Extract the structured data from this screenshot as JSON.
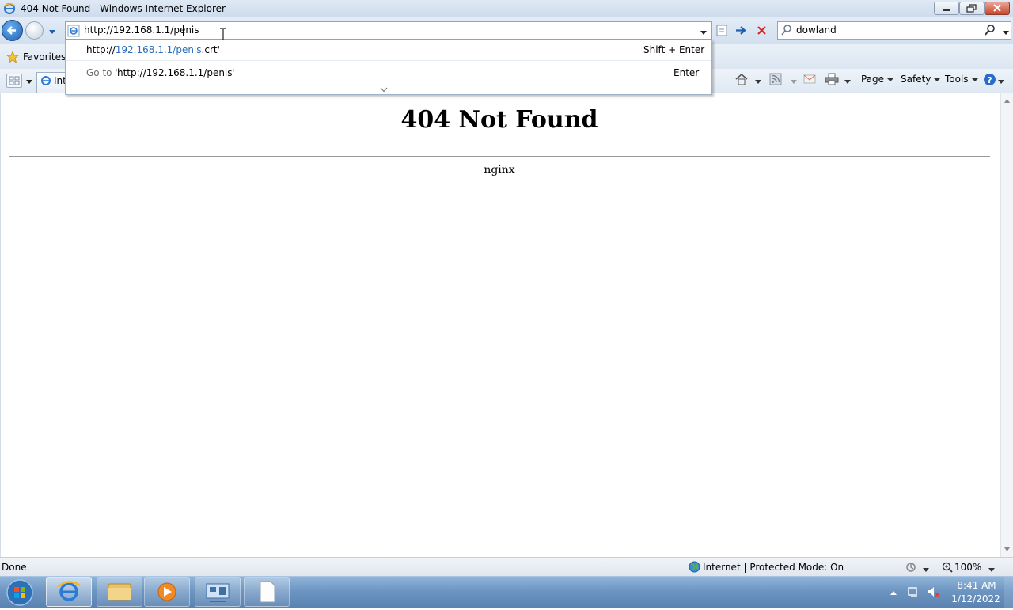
{
  "window": {
    "title": "404 Not Found - Windows Internet Explorer"
  },
  "navbar": {
    "address_value": "http://192.168.1.1/penis",
    "search_value": "dowland"
  },
  "dropdown": {
    "suggestion_prefix": "http://",
    "suggestion_highlight": "192.168.1.1/penis",
    "suggestion_suffix": ".crt'",
    "suggestion_shortcut": "Shift + Enter",
    "goto_prefix": "Go to '",
    "goto_url": "http://192.168.1.1/penis",
    "goto_suffix": "'",
    "goto_shortcut": "Enter"
  },
  "favorites_bar": {
    "favorites_label": "Favorites",
    "tab_label_partial": "Int"
  },
  "command_bar": {
    "page_label": "Page",
    "safety_label": "Safety",
    "tools_label": "Tools"
  },
  "page": {
    "heading": "404 Not Found",
    "server": "nginx"
  },
  "status_bar": {
    "status": "Done",
    "zone": "Internet | Protected Mode: On",
    "zoom": "100%"
  },
  "taskbar": {
    "time": "8:41 AM",
    "date": "1/12/2022"
  },
  "colors": {
    "link_highlight": "#2a6cb8",
    "close_button": "#c9462c",
    "taskbar": "#6d95c2"
  }
}
